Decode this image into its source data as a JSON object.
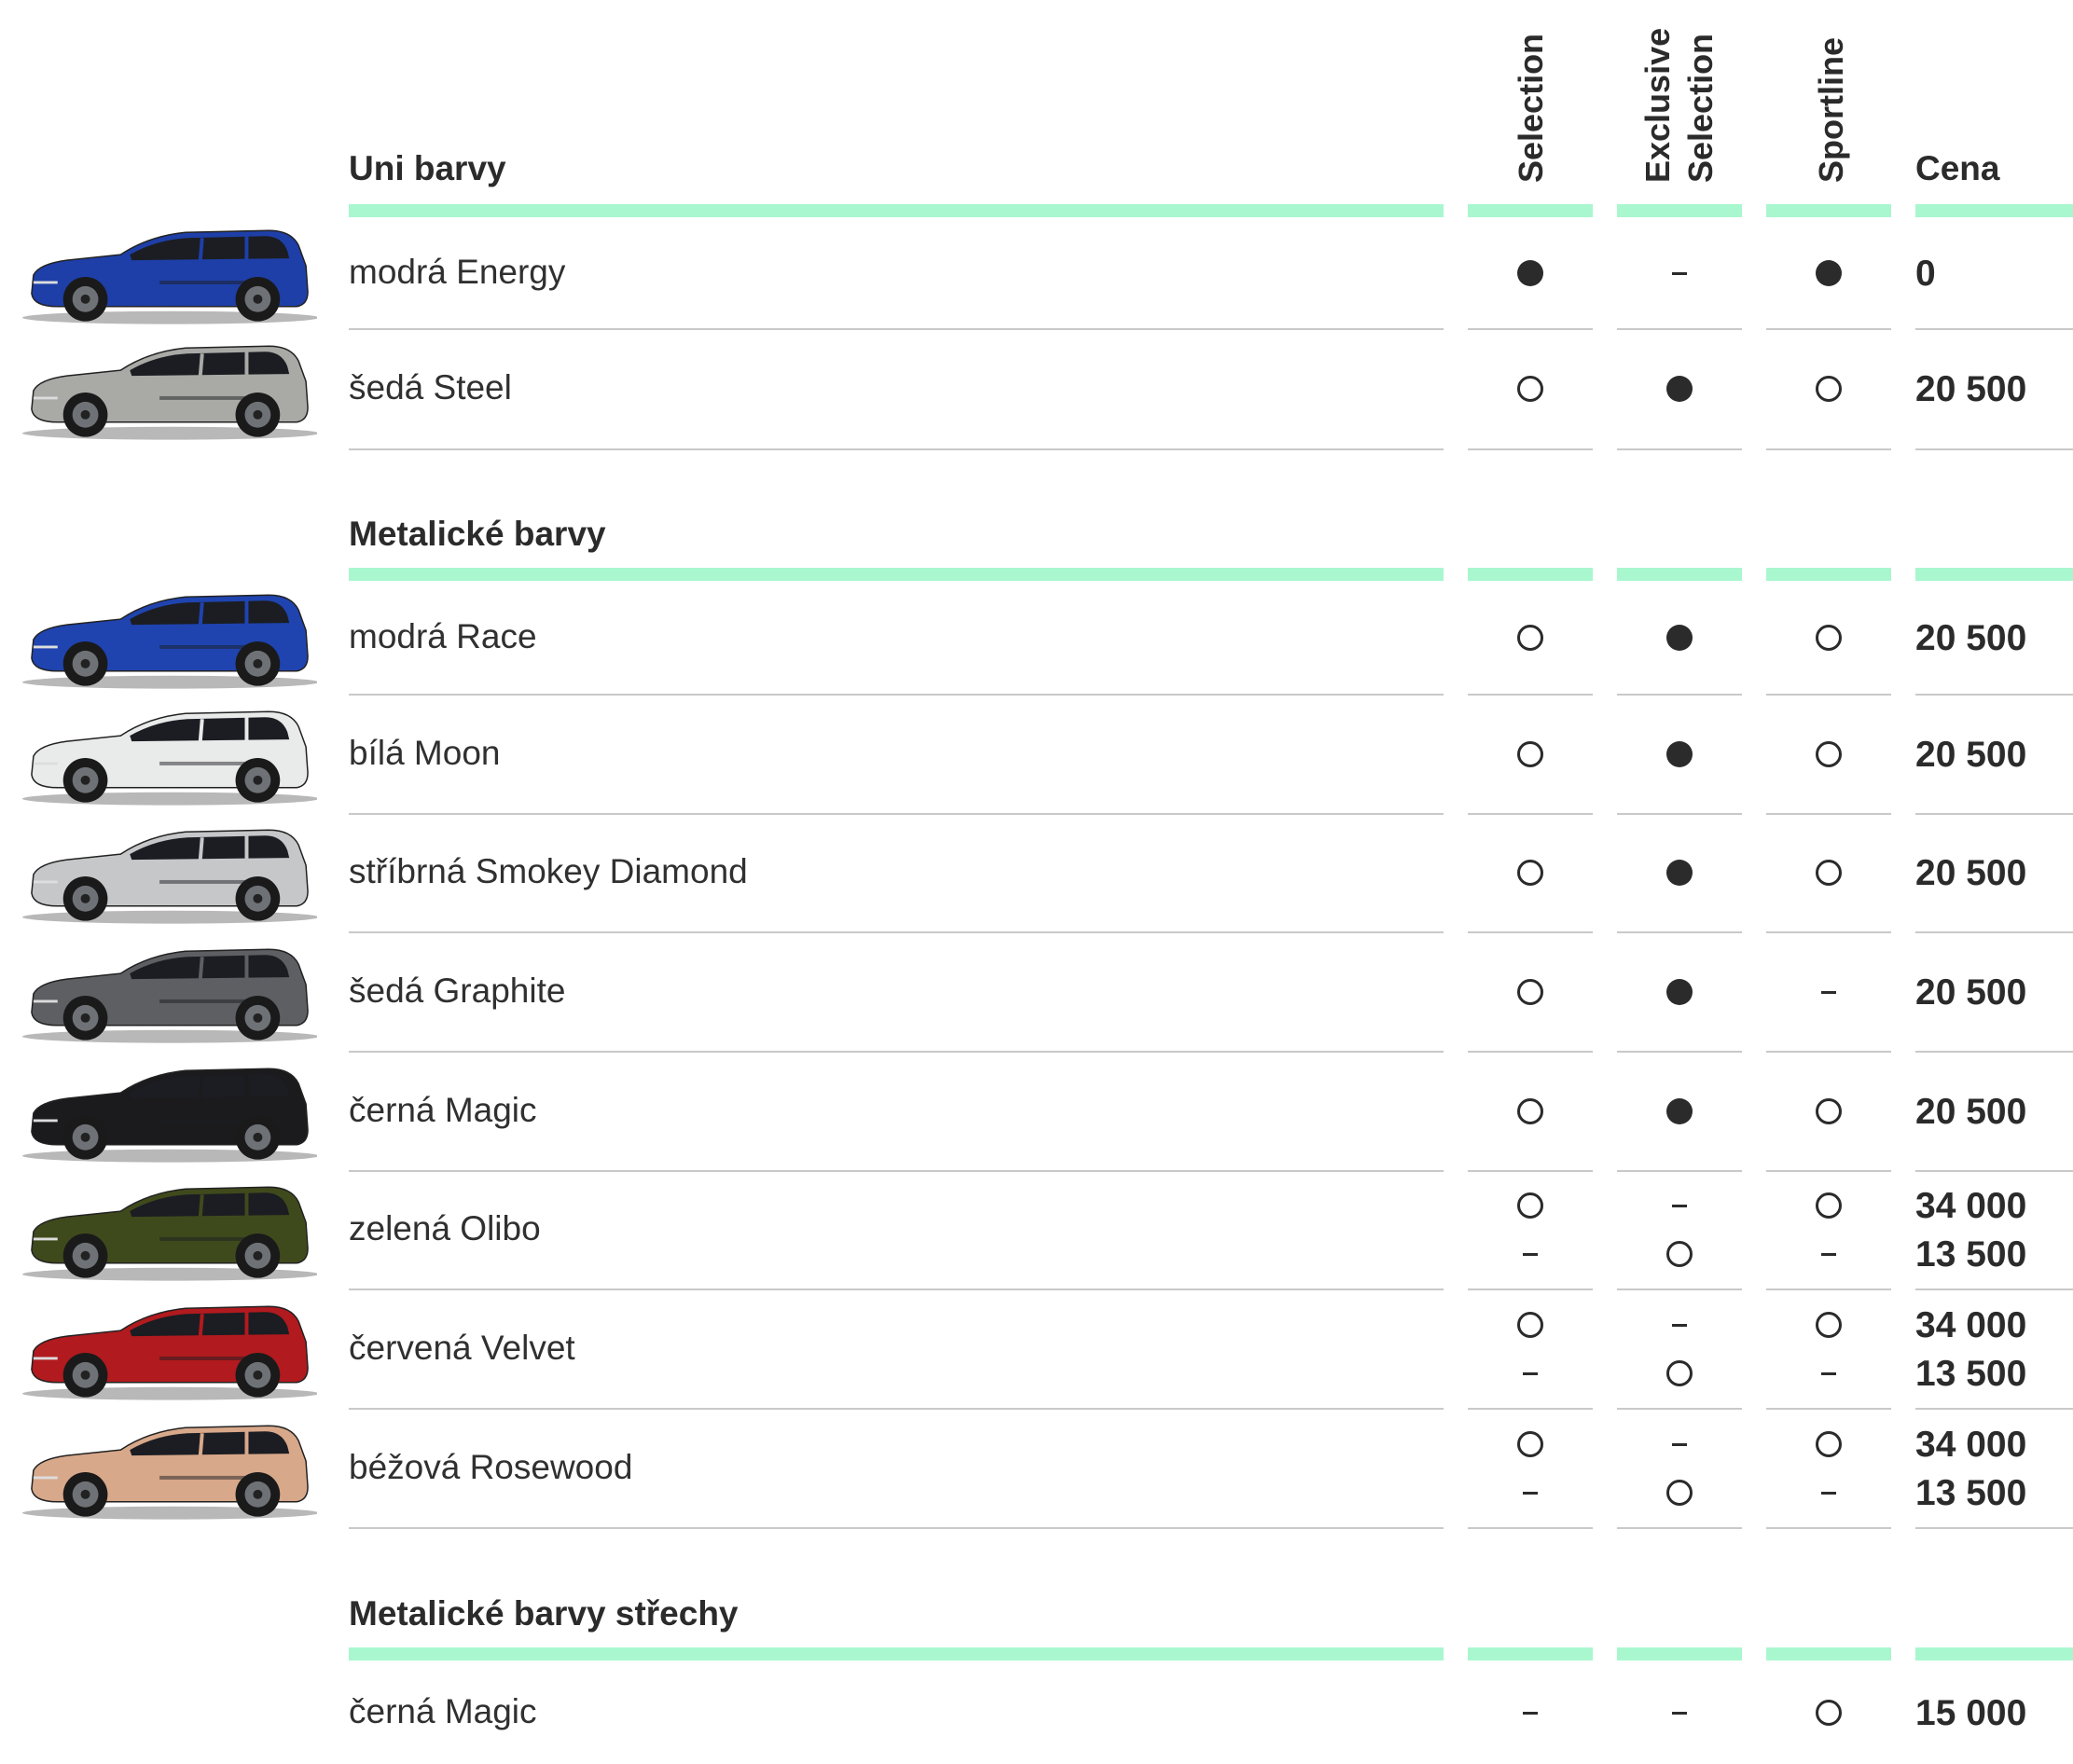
{
  "columns": {
    "selection": "Selection",
    "exclusive_line1": "Exclusive",
    "exclusive_line2": "Selection",
    "sportline": "Sportline",
    "price": "Cena"
  },
  "sections": [
    {
      "title": "Uni barvy",
      "rows": [
        {
          "label": "modrá Energy",
          "color": "#1e3fa8",
          "lines": [
            {
              "selection": "full",
              "exclusive": "none",
              "sportline": "full",
              "price": "0"
            }
          ]
        },
        {
          "label": "šedá Steel",
          "color": "#a9aaa6",
          "lines": [
            {
              "selection": "open",
              "exclusive": "full",
              "sportline": "open",
              "price": "20 500"
            }
          ]
        }
      ]
    },
    {
      "title": "Metalické barvy",
      "rows": [
        {
          "label": "modrá Race",
          "color": "#1f44b0",
          "lines": [
            {
              "selection": "open",
              "exclusive": "full",
              "sportline": "open",
              "price": "20 500"
            }
          ]
        },
        {
          "label": "bílá Moon",
          "color": "#e9eaea",
          "lines": [
            {
              "selection": "open",
              "exclusive": "full",
              "sportline": "open",
              "price": "20 500"
            }
          ]
        },
        {
          "label": "stříbrná Smokey Diamond",
          "color": "#c5c7c9",
          "lines": [
            {
              "selection": "open",
              "exclusive": "full",
              "sportline": "open",
              "price": "20 500"
            }
          ]
        },
        {
          "label": "šedá Graphite",
          "color": "#5d5f63",
          "lines": [
            {
              "selection": "open",
              "exclusive": "full",
              "sportline": "none",
              "price": "20 500"
            }
          ]
        },
        {
          "label": "černá Magic",
          "color": "#1b1b1d",
          "lines": [
            {
              "selection": "open",
              "exclusive": "full",
              "sportline": "open",
              "price": "20 500"
            }
          ]
        },
        {
          "label": "zelená Olibo",
          "color": "#3f4a1c",
          "lines": [
            {
              "selection": "open",
              "exclusive": "none",
              "sportline": "open",
              "price": "34 000"
            },
            {
              "selection": "none",
              "exclusive": "open",
              "sportline": "none",
              "price": "13 500"
            }
          ]
        },
        {
          "label": "červená Velvet",
          "color": "#b11a1e",
          "lines": [
            {
              "selection": "open",
              "exclusive": "none",
              "sportline": "open",
              "price": "34 000"
            },
            {
              "selection": "none",
              "exclusive": "open",
              "sportline": "none",
              "price": "13 500"
            }
          ]
        },
        {
          "label": "béžová Rosewood",
          "color": "#d8a88a",
          "lines": [
            {
              "selection": "open",
              "exclusive": "none",
              "sportline": "open",
              "price": "34 000"
            },
            {
              "selection": "none",
              "exclusive": "open",
              "sportline": "none",
              "price": "13 500"
            }
          ]
        }
      ]
    },
    {
      "title": "Metalické barvy střechy",
      "rows": [
        {
          "label": "černá Magic",
          "lines": [
            {
              "selection": "none",
              "exclusive": "none",
              "sportline": "open",
              "price": "15 000"
            }
          ]
        }
      ]
    }
  ]
}
